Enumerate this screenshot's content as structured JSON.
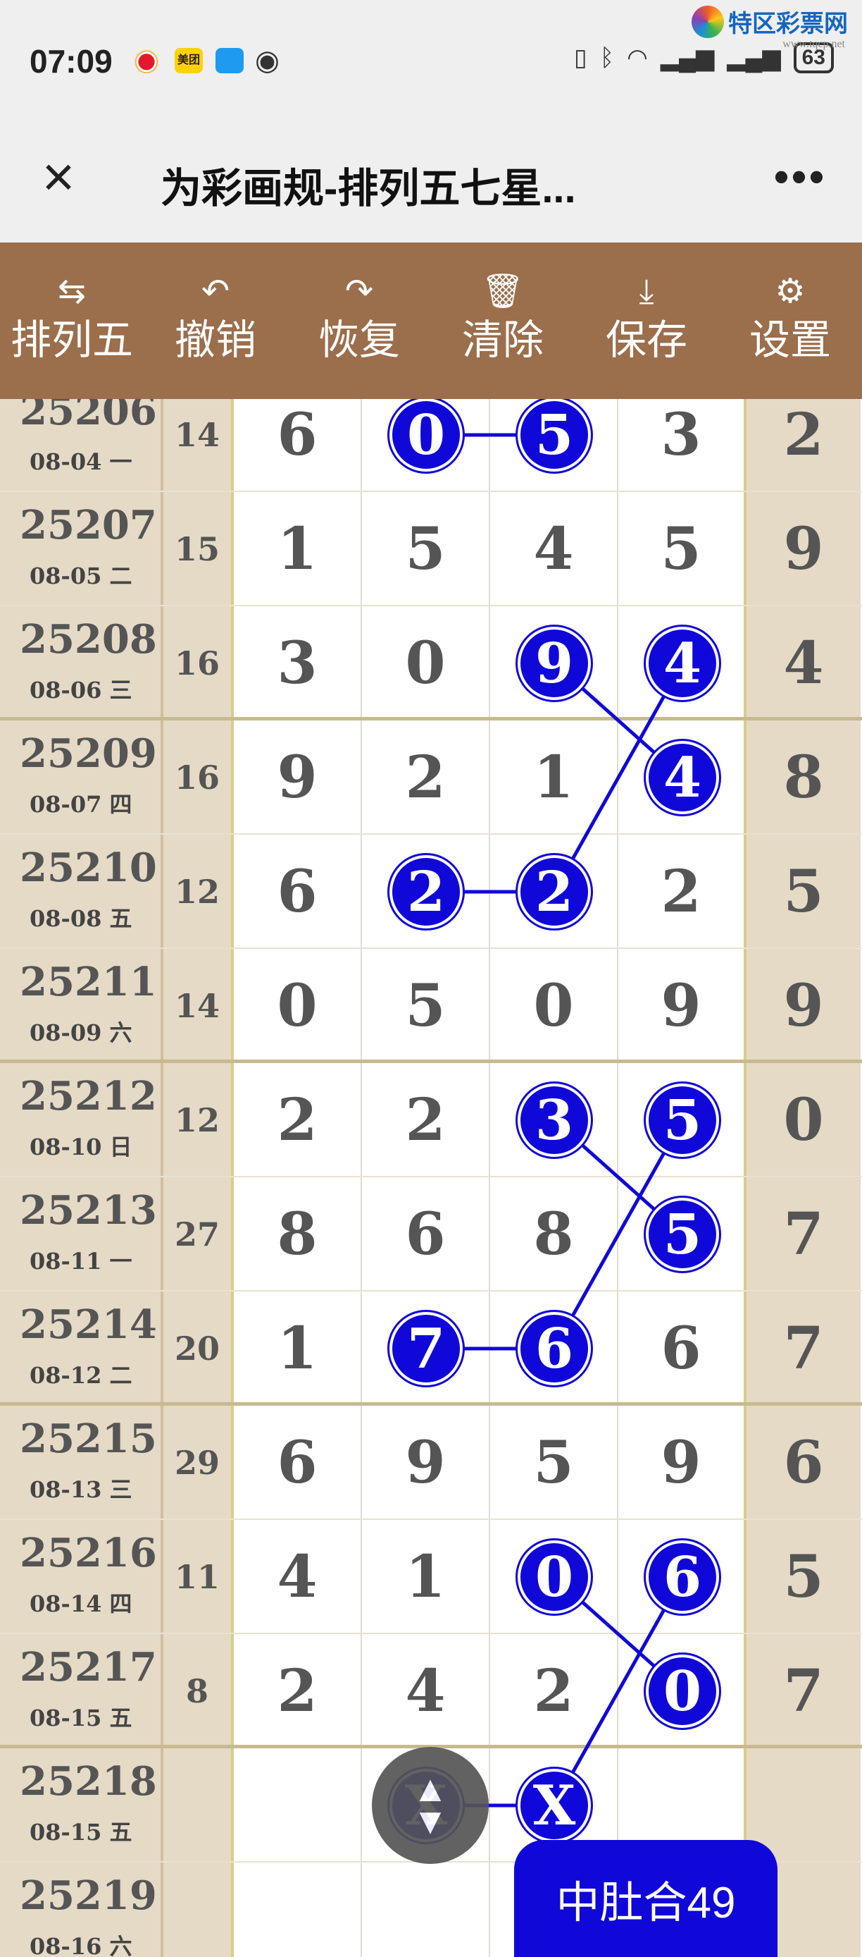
{
  "status_bar": {
    "time": "07:09",
    "battery": "63",
    "left_icons": [
      "weibo-icon",
      "meituan-icon",
      "chat-icon",
      "eye-icon"
    ],
    "right_icons": [
      "nfc-icon",
      "bluetooth-icon",
      "wifi-icon",
      "signal-icon",
      "signal-icon"
    ],
    "meituan": "美团"
  },
  "watermark": {
    "name": "特区彩票网",
    "url": "www.tqcp.net"
  },
  "titlebar": {
    "title": "为彩画规-排列五七星...",
    "close": "×",
    "more": "•••"
  },
  "toolbar": [
    {
      "label": "排列五",
      "icon": "swap-icon",
      "glyph": "⇆"
    },
    {
      "label": "撤销",
      "icon": "undo-icon",
      "glyph": "↶"
    },
    {
      "label": "恢复",
      "icon": "redo-icon",
      "glyph": "↷"
    },
    {
      "label": "清除",
      "icon": "trash-icon",
      "glyph": "🗑"
    },
    {
      "label": "保存",
      "icon": "download-icon",
      "glyph": "⤓"
    },
    {
      "label": "设置",
      "icon": "gear-icon",
      "glyph": "⚙"
    }
  ],
  "rows": [
    {
      "issue": "25206",
      "date": "08-04 一",
      "sum": "14",
      "digits": [
        "6",
        "0",
        "5",
        "3"
      ],
      "b": "2"
    },
    {
      "issue": "25207",
      "date": "08-05 二",
      "sum": "15",
      "digits": [
        "1",
        "5",
        "4",
        "5"
      ],
      "b": "9"
    },
    {
      "issue": "25208",
      "date": "08-06 三",
      "sum": "16",
      "digits": [
        "3",
        "0",
        "9",
        "4"
      ],
      "b": "4"
    },
    {
      "issue": "25209",
      "date": "08-07 四",
      "sum": "16",
      "digits": [
        "9",
        "2",
        "1",
        "4"
      ],
      "b": "8"
    },
    {
      "issue": "25210",
      "date": "08-08 五",
      "sum": "12",
      "digits": [
        "6",
        "2",
        "2",
        "2"
      ],
      "b": "5"
    },
    {
      "issue": "25211",
      "date": "08-09 六",
      "sum": "14",
      "digits": [
        "0",
        "5",
        "0",
        "9"
      ],
      "b": "9"
    },
    {
      "issue": "25212",
      "date": "08-10 日",
      "sum": "12",
      "digits": [
        "2",
        "2",
        "3",
        "5"
      ],
      "b": "0"
    },
    {
      "issue": "25213",
      "date": "08-11 一",
      "sum": "27",
      "digits": [
        "8",
        "6",
        "8",
        "5"
      ],
      "b": "7"
    },
    {
      "issue": "25214",
      "date": "08-12 二",
      "sum": "20",
      "digits": [
        "1",
        "7",
        "6",
        "6"
      ],
      "b": "7"
    },
    {
      "issue": "25215",
      "date": "08-13 三",
      "sum": "29",
      "digits": [
        "6",
        "9",
        "5",
        "9"
      ],
      "b": "6"
    },
    {
      "issue": "25216",
      "date": "08-14 四",
      "sum": "11",
      "digits": [
        "4",
        "1",
        "0",
        "6"
      ],
      "b": "5"
    },
    {
      "issue": "25217",
      "date": "08-15 五",
      "sum": "8",
      "digits": [
        "2",
        "4",
        "2",
        "0"
      ],
      "b": "7"
    },
    {
      "issue": "25218",
      "date": "08-15 五",
      "sum": "",
      "digits": [
        "",
        "X",
        "X",
        ""
      ],
      "b": ""
    },
    {
      "issue": "25219",
      "date": "08-16 六",
      "sum": "",
      "digits": [
        "",
        "",
        "",
        ""
      ],
      "b": ""
    }
  ],
  "circles": [
    {
      "row": 0,
      "col": 1,
      "v": "0"
    },
    {
      "row": 0,
      "col": 2,
      "v": "5"
    },
    {
      "row": 2,
      "col": 2,
      "v": "9"
    },
    {
      "row": 2,
      "col": 3,
      "v": "4"
    },
    {
      "row": 3,
      "col": 3,
      "v": "4"
    },
    {
      "row": 4,
      "col": 1,
      "v": "2"
    },
    {
      "row": 4,
      "col": 2,
      "v": "2"
    },
    {
      "row": 6,
      "col": 2,
      "v": "3"
    },
    {
      "row": 6,
      "col": 3,
      "v": "5"
    },
    {
      "row": 7,
      "col": 3,
      "v": "5"
    },
    {
      "row": 8,
      "col": 1,
      "v": "7"
    },
    {
      "row": 8,
      "col": 2,
      "v": "6"
    },
    {
      "row": 10,
      "col": 2,
      "v": "0"
    },
    {
      "row": 10,
      "col": 3,
      "v": "6"
    },
    {
      "row": 11,
      "col": 3,
      "v": "0"
    },
    {
      "row": 12,
      "col": 1,
      "v": "X"
    },
    {
      "row": 12,
      "col": 2,
      "v": "X"
    }
  ],
  "lines": [
    [
      [
        0,
        1
      ],
      [
        0,
        2
      ]
    ],
    [
      [
        2,
        2
      ],
      [
        3,
        3
      ]
    ],
    [
      [
        2,
        3
      ],
      [
        4,
        2
      ]
    ],
    [
      [
        4,
        1
      ],
      [
        4,
        2
      ]
    ],
    [
      [
        6,
        2
      ],
      [
        7,
        3
      ]
    ],
    [
      [
        6,
        3
      ],
      [
        8,
        2
      ]
    ],
    [
      [
        8,
        1
      ],
      [
        8,
        2
      ]
    ],
    [
      [
        10,
        2
      ],
      [
        11,
        3
      ]
    ],
    [
      [
        10,
        3
      ],
      [
        12,
        2
      ]
    ],
    [
      [
        12,
        1
      ],
      [
        12,
        2
      ]
    ]
  ],
  "fab": {
    "icon": "scroll-arrows-icon",
    "up": "▲",
    "down": "▼"
  },
  "badge": {
    "label": "中肚合49"
  },
  "colors": {
    "toolbar": "#9b6e4c",
    "circle": "#1008d8",
    "side": "#e5dac6"
  }
}
